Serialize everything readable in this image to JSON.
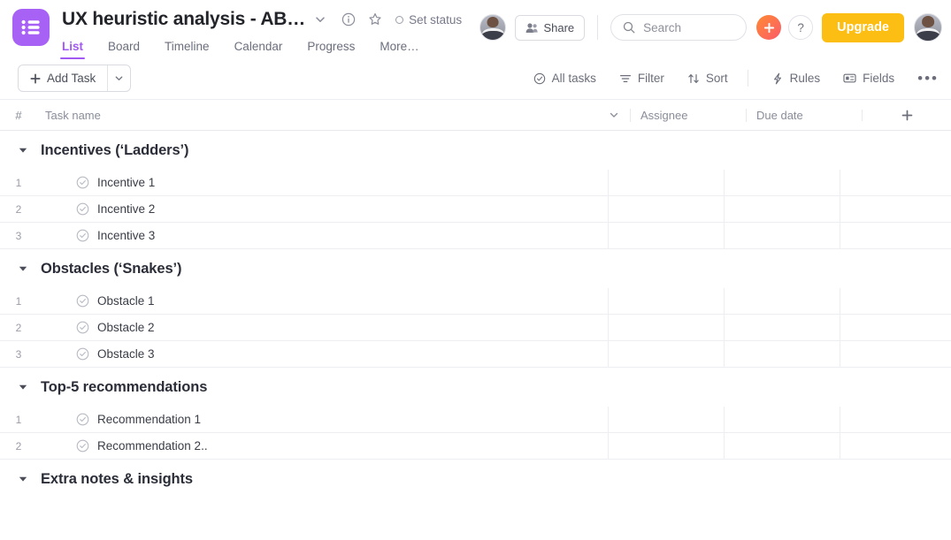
{
  "app": {
    "logo_icon": "list-logo-icon",
    "accent_purple": "#a259f4",
    "upgrade_color": "#fdbe13",
    "plus_gradient": [
      "#ff8a33",
      "#fb5b6b"
    ]
  },
  "header": {
    "title": "UX heuristic analysis - AB…",
    "title_caret_icon": "chevron-down-icon",
    "info_icon": "info-circle-icon",
    "star_icon": "star-icon",
    "set_status_label": "Set status",
    "set_status_icon": "status-circle-icon",
    "tabs": [
      {
        "label": "List",
        "active": true
      },
      {
        "label": "Board",
        "active": false
      },
      {
        "label": "Timeline",
        "active": false
      },
      {
        "label": "Calendar",
        "active": false
      },
      {
        "label": "Progress",
        "active": false
      },
      {
        "label": "More…",
        "active": false
      }
    ],
    "share_label": "Share",
    "share_icon": "people-icon",
    "search": {
      "icon": "search-icon",
      "placeholder": "Search",
      "value": ""
    },
    "plus_label": "+",
    "help_label": "?",
    "upgrade_label": "Upgrade",
    "avatar_left": "user-avatar",
    "avatar_right": "user-avatar"
  },
  "toolbar": {
    "add_task_label": "Add Task",
    "add_task_icon": "plus-icon",
    "add_task_caret_icon": "chevron-down-icon",
    "items": [
      {
        "label": "All tasks",
        "icon": "check-circle-icon"
      },
      {
        "label": "Filter",
        "icon": "filter-icon"
      },
      {
        "label": "Sort",
        "icon": "sort-icon"
      },
      {
        "label": "Rules",
        "icon": "bolt-icon"
      },
      {
        "label": "Fields",
        "icon": "fields-icon"
      }
    ],
    "overflow_label": "•••",
    "overflow_icon": "ellipsis-icon"
  },
  "table": {
    "columns": {
      "num": "#",
      "task_name": "Task name",
      "task_name_caret_icon": "chevron-down-icon",
      "assignee": "Assignee",
      "due_date": "Due date",
      "add_column_icon": "plus-icon"
    },
    "groups": [
      {
        "title": "Incentives (‘Ladders’)",
        "caret_icon": "caret-down-icon",
        "rows": [
          {
            "num": "1",
            "name": "Incentive 1",
            "status_icon": "check-circle-icon",
            "assignee": "",
            "due_date": ""
          },
          {
            "num": "2",
            "name": "Incentive 2",
            "status_icon": "check-circle-icon",
            "assignee": "",
            "due_date": ""
          },
          {
            "num": "3",
            "name": "Incentive 3",
            "status_icon": "check-circle-icon",
            "assignee": "",
            "due_date": ""
          }
        ]
      },
      {
        "title": "Obstacles (‘Snakes’)",
        "caret_icon": "caret-down-icon",
        "rows": [
          {
            "num": "1",
            "name": "Obstacle 1",
            "status_icon": "check-circle-icon",
            "assignee": "",
            "due_date": ""
          },
          {
            "num": "2",
            "name": "Obstacle 2",
            "status_icon": "check-circle-icon",
            "assignee": "",
            "due_date": ""
          },
          {
            "num": "3",
            "name": "Obstacle 3",
            "status_icon": "check-circle-icon",
            "assignee": "",
            "due_date": ""
          }
        ]
      },
      {
        "title": "Top-5 recommendations",
        "caret_icon": "caret-down-icon",
        "rows": [
          {
            "num": "1",
            "name": "Recommendation 1",
            "status_icon": "check-circle-icon",
            "assignee": "",
            "due_date": ""
          },
          {
            "num": "2",
            "name": "Recommendation 2..",
            "status_icon": "check-circle-icon",
            "assignee": "",
            "due_date": ""
          }
        ]
      },
      {
        "title": "Extra notes & insights",
        "caret_icon": "caret-down-icon",
        "rows": []
      }
    ]
  }
}
